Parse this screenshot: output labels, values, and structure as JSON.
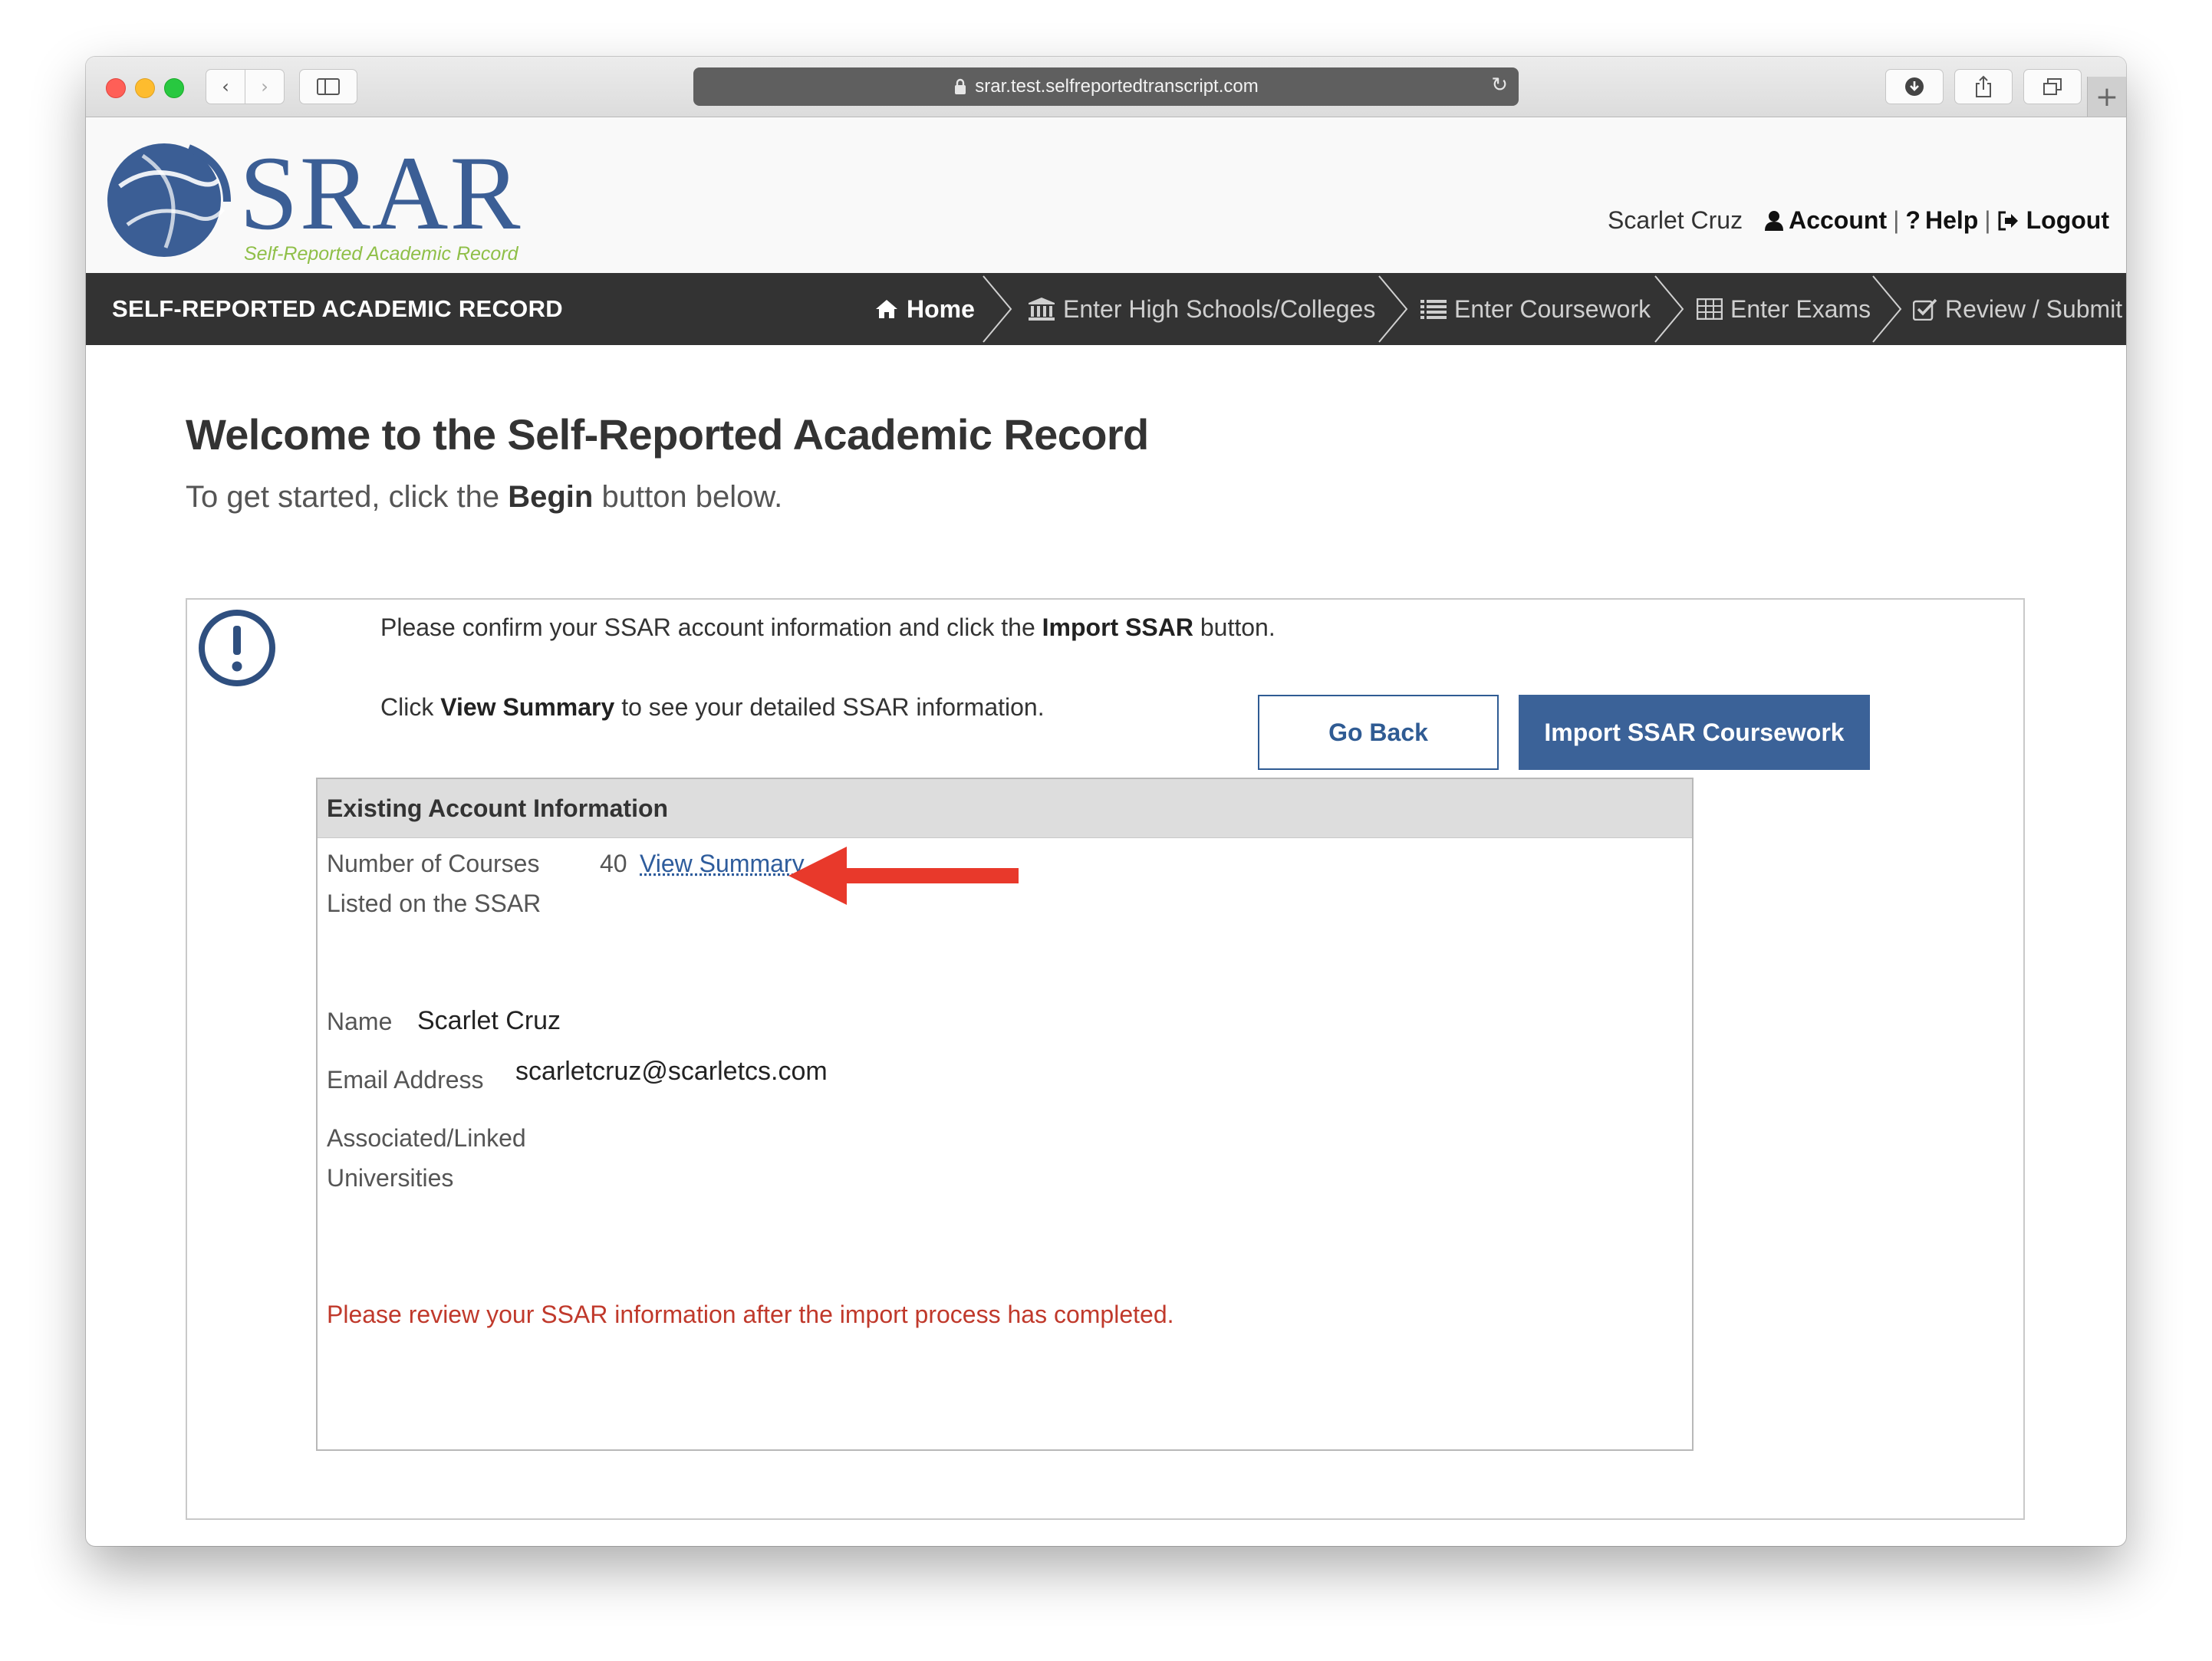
{
  "browser": {
    "url": "srar.test.selfreportedtranscript.com",
    "colors": {
      "close": "#ff5f57",
      "minimize": "#febc2e",
      "zoom": "#28c840"
    }
  },
  "header": {
    "logo_text": "SRAR",
    "logo_tagline": "Self-Reported Academic Record",
    "user_name": "Scarlet Cruz",
    "account_label": "Account",
    "help_label": "Help",
    "logout_label": "Logout",
    "separator": "|"
  },
  "nav": {
    "brand": "SELF-REPORTED ACADEMIC RECORD",
    "items": [
      {
        "label": "Home",
        "icon": "home-icon",
        "active": true
      },
      {
        "label": "Enter High Schools/Colleges",
        "icon": "institution-icon",
        "active": false
      },
      {
        "label": "Enter Coursework",
        "icon": "list-icon",
        "active": false
      },
      {
        "label": "Enter Exams",
        "icon": "table-icon",
        "active": false
      },
      {
        "label": "Review / Submit",
        "icon": "check-square-icon",
        "active": false
      }
    ]
  },
  "main": {
    "title": "Welcome to the Self-Reported Academic Record",
    "subtitle_pre": "To get started, click the",
    "subtitle_bold": "Begin",
    "subtitle_post": "button below.",
    "message1_pre": "Please confirm your SSAR account information and click the",
    "message1_bold": "Import SSAR",
    "message1_post": "button.",
    "message2_pre": "Click",
    "message2_bold": "View Summary",
    "message2_post": "to see your detailed SSAR information."
  },
  "account_info": {
    "heading": "Existing Account Information",
    "courses_label_line1": "Number of Courses",
    "courses_label_line2": "Listed on the SSAR",
    "courses_count": "40",
    "view_summary": "View Summary",
    "name_label": "Name",
    "name_value": "Scarlet Cruz",
    "email_label": "Email Address",
    "email_value": "scarletcruz@scarletcs.com",
    "universities_label_line1": "Associated/Linked",
    "universities_label_line2": "Universities",
    "warning": "Please review your SSAR information after the import process has completed.",
    "go_back": "Go Back",
    "import": "Import SSAR Coursework"
  },
  "colors": {
    "brand_blue": "#3b5e95",
    "nav_bg": "#333333",
    "button_primary": "#3b6298",
    "warning_red": "#c0392b",
    "annotation_arrow": "#e8392b",
    "tagline_green": "#8fbf48"
  }
}
